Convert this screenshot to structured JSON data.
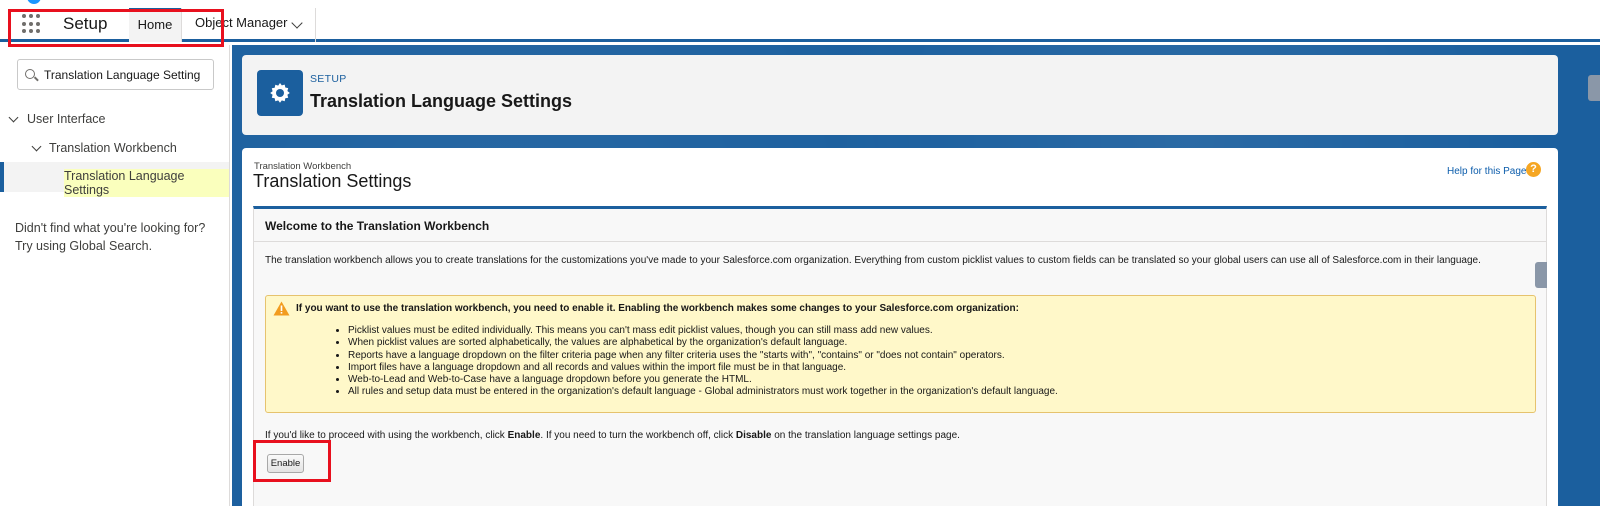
{
  "topbar": {
    "app_name": "Setup",
    "tabs": [
      {
        "label": "Home"
      },
      {
        "label": "Object Manager"
      }
    ]
  },
  "sidebar": {
    "search_value": "Translation Language Setting",
    "tree": [
      {
        "label": "User Interface"
      },
      {
        "label": "Translation Workbench"
      },
      {
        "label": "Translation Language Settings"
      }
    ],
    "not_found_line1": "Didn't find what you're looking for?",
    "not_found_line2": "Try using Global Search."
  },
  "header": {
    "kicker": "SETUP",
    "title": "Translation Language Settings",
    "icon": "gear-icon"
  },
  "page": {
    "breadcrumb": "Translation Workbench",
    "title": "Translation Settings",
    "help_label": "Help for this Page",
    "help_icon": "?"
  },
  "panel": {
    "heading": "Welcome to the Translation Workbench",
    "intro": "The translation workbench allows you to create translations for the customizations you've made to your Salesforce.com organization. Everything from custom picklist values to custom fields can be translated so your global users can use all of Salesforce.com in their language.",
    "warning": {
      "heading": "If you want to use the translation workbench, you need to enable it. Enabling the workbench makes some changes to your Salesforce.com organization:",
      "items": [
        "Picklist values must be edited individually. This means you can't mass edit picklist values, though you can still mass add new values.",
        "When picklist values are sorted alphabetically, the values are alphabetical by the organization's default language.",
        "Reports have a language dropdown on the filter criteria page when any filter criteria uses the \"starts with\", \"contains\" or \"does not contain\" operators.",
        "Import files have a language dropdown and all records and values within the import file must be in that language.",
        "Web-to-Lead and Web-to-Case have a language dropdown before you generate the HTML.",
        "All rules and setup data must be entered in the organization's default language - Global administrators must work together in the organization's default language."
      ]
    },
    "proceed": {
      "part1": "If you'd like to proceed with using the workbench, click ",
      "enable_word": "Enable",
      "part2": ". If you need to turn the workbench off, click ",
      "disable_word": "Disable",
      "part3": " on the translation language settings page."
    },
    "enable_button": "Enable"
  },
  "colors": {
    "brand": "#1b5f9e",
    "highlight_box": "#e8101e",
    "warning_bg": "#fff8c9"
  }
}
